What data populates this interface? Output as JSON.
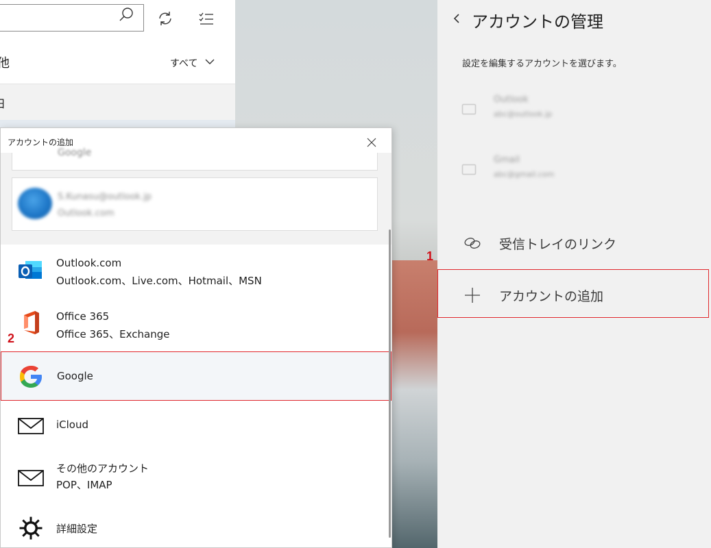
{
  "mail_pane": {
    "search_placeholder": "",
    "folder_name": "他",
    "filter_label": "すべて",
    "day_group": "日"
  },
  "settings": {
    "title": "アカウントの管理",
    "description": "設定を編集するアカウントを選びます。",
    "accounts": [
      {
        "name": "Outlook",
        "email": "abc@outlook.jp"
      },
      {
        "name": "Gmail",
        "email": "abc@gmail.com"
      }
    ],
    "link_inboxes": "受信トレイのリンク",
    "add_account": "アカウントの追加"
  },
  "dialog": {
    "title": "アカウントの追加",
    "existing_partial": "Google",
    "existing_account": {
      "email": "S.Kunasu@outlook.jp",
      "type": "Outlook.com"
    },
    "providers": [
      {
        "name": "Outlook.com",
        "sub": "Outlook.com、Live.com、Hotmail、MSN",
        "icon": "outlook-icon"
      },
      {
        "name": "Office 365",
        "sub": "Office 365、Exchange",
        "icon": "office365-icon"
      },
      {
        "name": "Google",
        "sub": "",
        "icon": "google-icon"
      },
      {
        "name": "iCloud",
        "sub": "",
        "icon": "mail-icon"
      },
      {
        "name": "その他のアカウント",
        "sub": "POP、IMAP",
        "icon": "mail-icon"
      },
      {
        "name": "詳細設定",
        "sub": "",
        "icon": "gear-icon"
      }
    ]
  },
  "annotations": {
    "step1": "1",
    "step2": "2"
  },
  "colors": {
    "highlight": "#e0262b",
    "step_number": "#d0111a",
    "settings_bg": "#f1f1f1"
  }
}
